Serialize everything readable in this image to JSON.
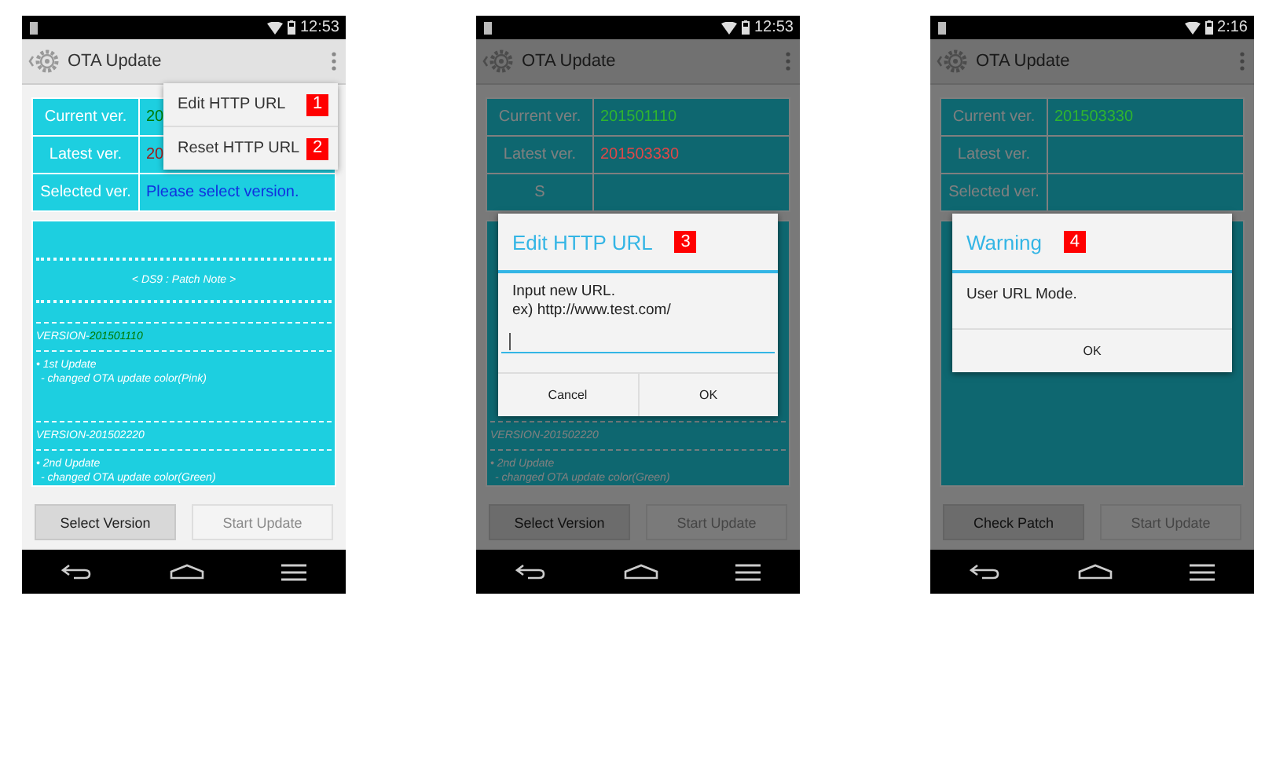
{
  "screens": [
    {
      "status_time": "12:53",
      "app_title": "OTA Update",
      "dimmed": false,
      "info_rows": [
        {
          "label": "Current ver.",
          "value": "20",
          "color": "#007a00"
        },
        {
          "label": "Latest ver.",
          "value": "20",
          "color": "#a01818"
        },
        {
          "label": "Selected ver.",
          "value": "Please select version.",
          "color": "#1030e0"
        }
      ],
      "patch_notes": [
        {
          "kind": "stars"
        },
        {
          "kind": "title",
          "text": "< DS9 : Patch Note >"
        },
        {
          "kind": "stars"
        },
        {
          "kind": "dashes"
        },
        {
          "kind": "version",
          "prefix": "VERSION-",
          "number": "201501110",
          "color": "#007a00"
        },
        {
          "kind": "dashes"
        },
        {
          "kind": "bullet",
          "text": "• 1st Update"
        },
        {
          "kind": "detail",
          "text": "- changed OTA update color(Pink)"
        },
        {
          "kind": "gap"
        },
        {
          "kind": "dashes"
        },
        {
          "kind": "version",
          "prefix": "VERSION-",
          "number": "201502220"
        },
        {
          "kind": "dashes"
        },
        {
          "kind": "bullet",
          "text": "• 2nd Update"
        },
        {
          "kind": "detail",
          "text": "- changed OTA update color(Green)"
        }
      ],
      "buttons": [
        {
          "label": "Select Version",
          "disabled": false
        },
        {
          "label": "Start Update",
          "disabled": true
        }
      ],
      "overlay": {
        "kind": "menu",
        "items": [
          {
            "label": "Edit HTTP URL",
            "badge": "1"
          },
          {
            "label": "Reset HTTP URL",
            "badge": "2"
          }
        ]
      }
    },
    {
      "status_time": "12:53",
      "app_title": "OTA Update",
      "dimmed": true,
      "info_rows": [
        {
          "label": "Current ver.",
          "value": "201501110",
          "color": "#2fb52f"
        },
        {
          "label": "Latest ver.",
          "value": "201503330",
          "color": "#e04848"
        },
        {
          "label": "S"
        }
      ],
      "patch_notes": [
        {
          "kind": "dashes"
        },
        {
          "kind": "version",
          "prefix": "VERSION-",
          "number": "201502220"
        },
        {
          "kind": "dashes"
        },
        {
          "kind": "bullet",
          "text": "• 2nd Update"
        },
        {
          "kind": "detail",
          "text": "- changed OTA update color(Green)"
        }
      ],
      "buttons": [
        {
          "label": "Select Version",
          "disabled": false
        },
        {
          "label": "Start Update",
          "disabled": true
        }
      ],
      "overlay": {
        "kind": "input_dialog",
        "title": "Edit HTTP URL",
        "badge": "3",
        "message_lines": [
          "Input new URL.",
          "ex) http://www.test.com/"
        ],
        "buttons": [
          "Cancel",
          "OK"
        ]
      }
    },
    {
      "status_time": "2:16",
      "app_title": "OTA Update",
      "dimmed": true,
      "info_rows": [
        {
          "label": "Current ver.",
          "value": "201503330",
          "color": "#2fb52f"
        },
        {
          "label": "Latest ver."
        },
        {
          "label": "Selected ver."
        }
      ],
      "buttons": [
        {
          "label": "Check Patch",
          "disabled": false
        },
        {
          "label": "Start Update",
          "disabled": true
        }
      ],
      "overlay": {
        "kind": "message_dialog",
        "title": "Warning",
        "badge": "4",
        "message_lines": [
          "User URL Mode."
        ],
        "buttons": [
          "OK"
        ]
      }
    }
  ]
}
